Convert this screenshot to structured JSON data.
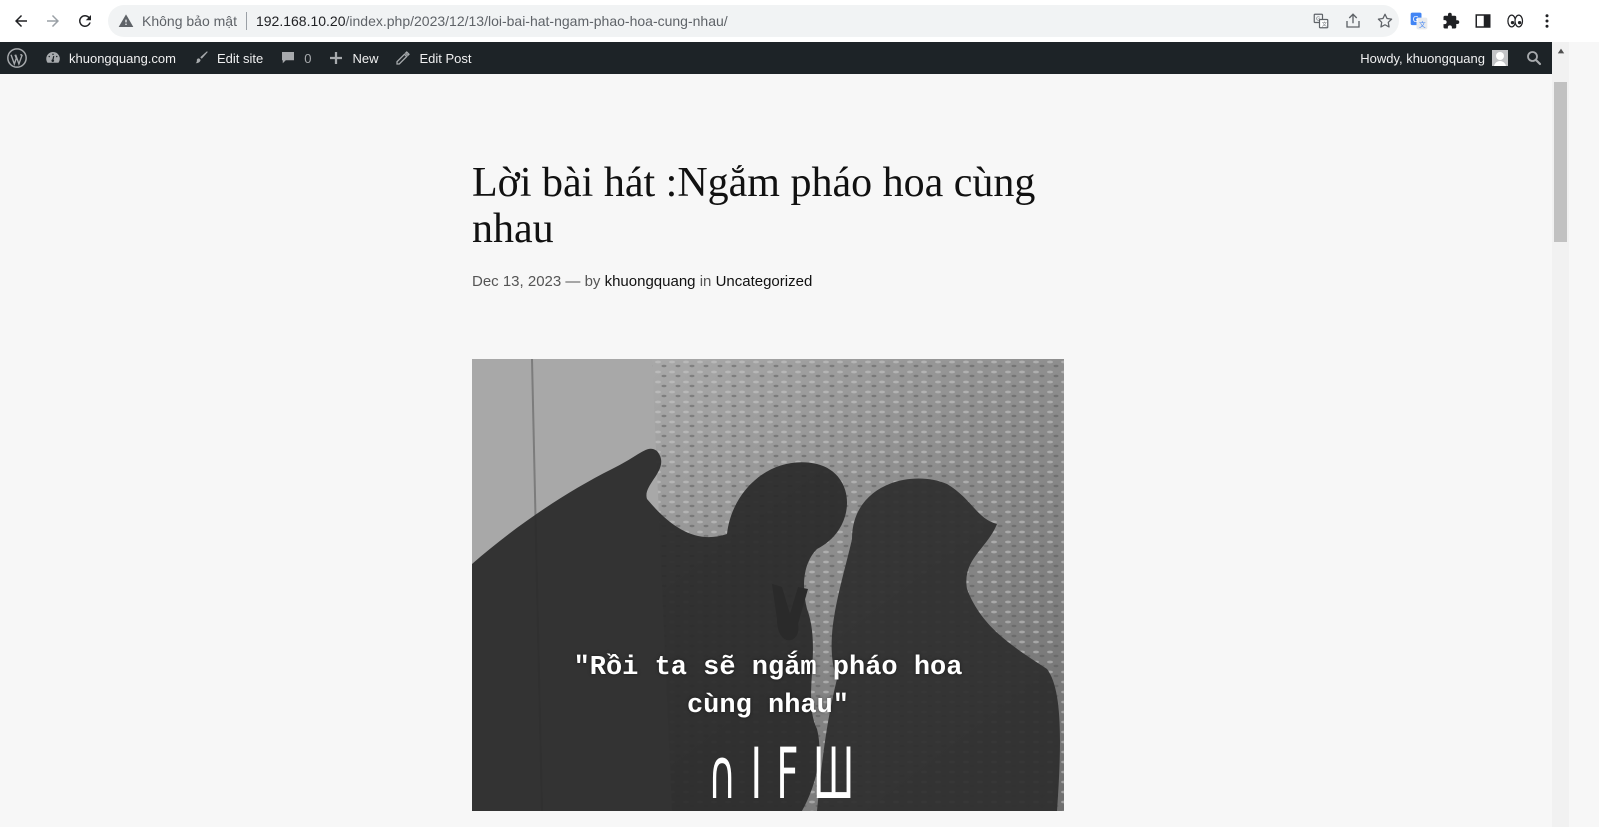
{
  "browser": {
    "security_label": "Không bảo mật",
    "url_host": "192.168.10.20",
    "url_path": "/index.php/2023/12/13/loi-bai-hat-ngam-phao-hoa-cung-nhau/"
  },
  "adminbar": {
    "site_name": "khuongquang.com",
    "edit_site": "Edit site",
    "comments_count": "0",
    "new_label": "New",
    "edit_post": "Edit Post",
    "howdy": "Howdy, khuongquang"
  },
  "post": {
    "title": "Lời bài hát :Ngắm pháo hoa cùng nhau",
    "date": "Dec 13, 2023",
    "by": "— by",
    "author": "khuongquang",
    "in": "in",
    "category": "Uncategorized"
  },
  "image": {
    "quote_line1": "\"Rồi ta sẽ ngắm pháo hoa",
    "quote_line2": "cùng nhau\"",
    "logo_text": "∩ I F Ш"
  },
  "colors": {
    "adminbar_bg": "#1d2327",
    "page_bg": "#f7f7f7"
  }
}
